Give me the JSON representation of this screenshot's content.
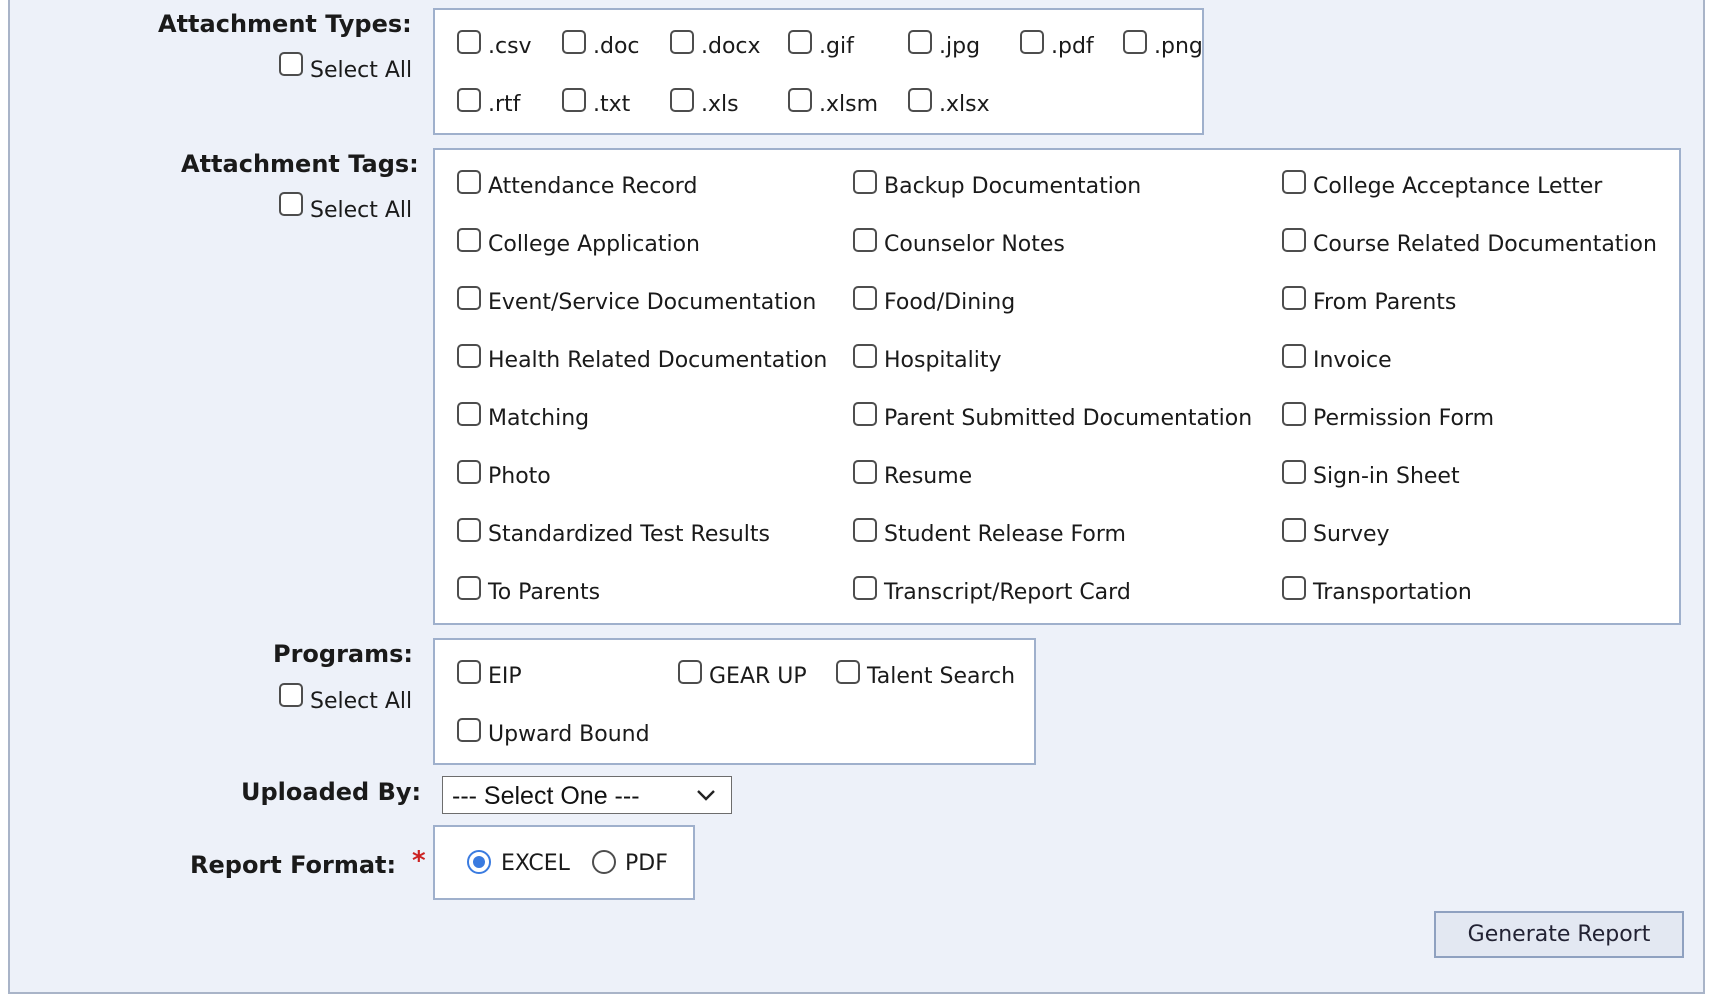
{
  "attachment_types": {
    "label": "Attachment Types:",
    "select_all": "Select All",
    "options": [
      ".csv",
      ".doc",
      ".docx",
      ".gif",
      ".jpg",
      ".pdf",
      ".png",
      ".rtf",
      ".txt",
      ".xls",
      ".xlsm",
      ".xlsx"
    ]
  },
  "attachment_tags": {
    "label": "Attachment Tags:",
    "select_all": "Select All",
    "options": [
      "Attendance Record",
      "Backup Documentation",
      "College Acceptance Letter",
      "College Application",
      "Counselor Notes",
      "Course Related Documentation",
      "Event/Service Documentation",
      "Food/Dining",
      "From Parents",
      "Health Related Documentation",
      "Hospitality",
      "Invoice",
      "Matching",
      "Parent Submitted Documentation",
      "Permission Form",
      "Photo",
      "Resume",
      "Sign-in Sheet",
      "Standardized Test Results",
      "Student Release Form",
      "Survey",
      "To Parents",
      "Transcript/Report Card",
      "Transportation"
    ]
  },
  "programs": {
    "label": "Programs:",
    "select_all": "Select All",
    "options": [
      "EIP",
      "GEAR UP",
      "Talent Search",
      "Upward Bound"
    ]
  },
  "uploaded_by": {
    "label": "Uploaded By:",
    "selected": "--- Select One ---"
  },
  "report_format": {
    "label": "Report Format:",
    "required_mark": "*",
    "options": [
      "EXCEL",
      "PDF"
    ],
    "selected": "EXCEL"
  },
  "actions": {
    "generate": "Generate Report"
  },
  "colors": {
    "panel_bg": "#edf1f9",
    "box_border": "#9fb0cc",
    "radio_accent": "#3a7be0",
    "required": "#cc2222"
  }
}
